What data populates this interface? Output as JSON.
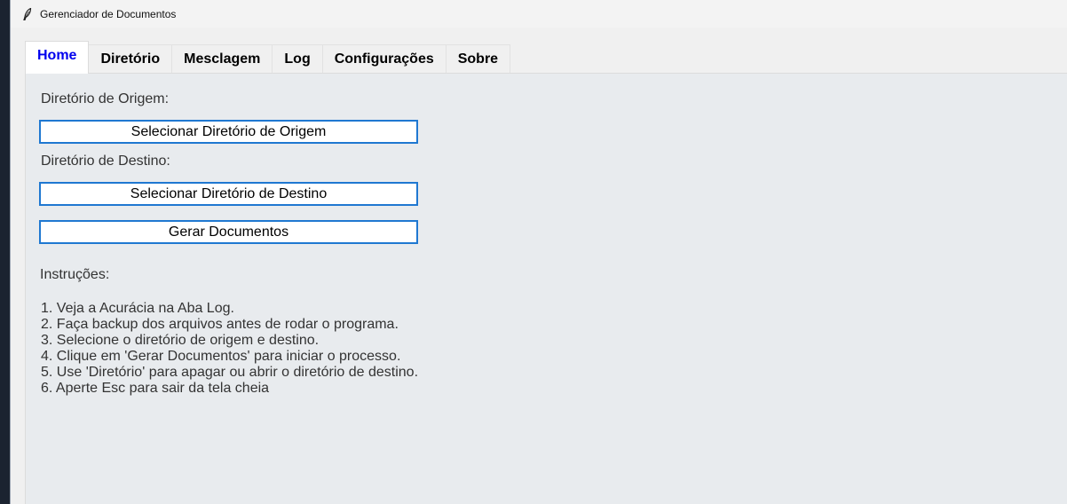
{
  "window": {
    "title": "Gerenciador de Documentos",
    "icon": "feather-icon"
  },
  "tabs": [
    {
      "label": "Home",
      "active": true
    },
    {
      "label": "Diretório",
      "active": false
    },
    {
      "label": "Mesclagem",
      "active": false
    },
    {
      "label": "Log",
      "active": false
    },
    {
      "label": "Configurações",
      "active": false
    },
    {
      "label": "Sobre",
      "active": false
    }
  ],
  "home": {
    "origin_label": "Diretório de Origem:",
    "origin_button": "Selecionar Diretório de Origem",
    "dest_label": "Diretório de Destino:",
    "dest_button": "Selecionar Diretório de Destino",
    "generate_button": "Gerar Documentos",
    "instructions_title": "Instruções:",
    "instructions": [
      "1. Veja a Acurácia na Aba Log.",
      "2. Faça backup dos arquivos antes de rodar o programa.",
      "3. Selecione o diretório de origem e destino.",
      "4. Clique em 'Gerar Documentos' para iniciar o processo.",
      "5. Use 'Diretório' para apagar ou abrir o diretório de destino.",
      "6. Aperte Esc para sair da tela cheia"
    ]
  },
  "colors": {
    "active_tab_text": "#0000ee",
    "button_border": "#1f78d1",
    "panel_background": "#e8ebee"
  }
}
